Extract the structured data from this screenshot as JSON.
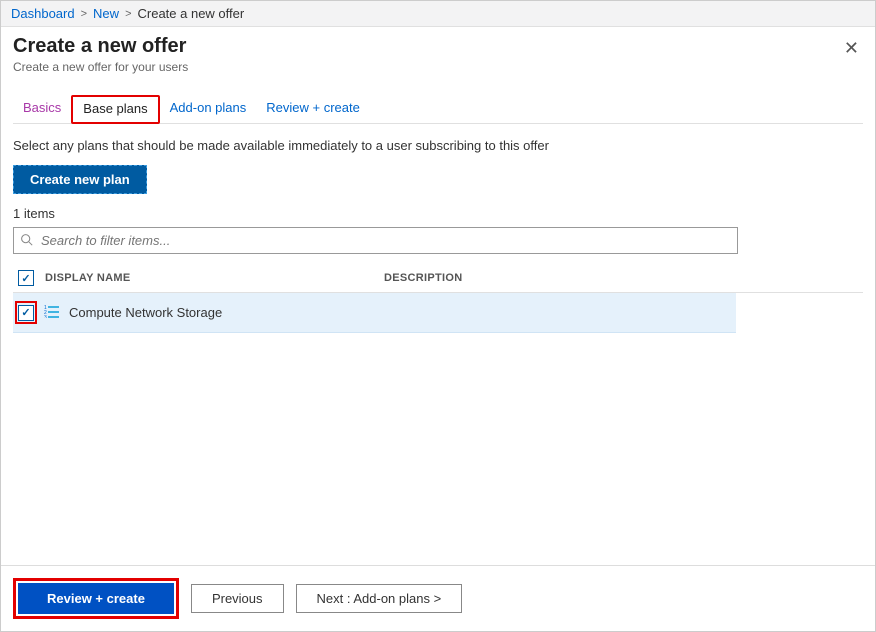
{
  "breadcrumb": {
    "items": [
      "Dashboard",
      "New"
    ],
    "current": "Create a new offer"
  },
  "header": {
    "title": "Create a new offer",
    "subtitle": "Create a new offer for your users"
  },
  "tabs": {
    "basics": "Basics",
    "base_plans": "Base plans",
    "addon_plans": "Add-on plans",
    "review_create": "Review + create"
  },
  "instructions": "Select any plans that should be made available immediately to a user subscribing to this offer",
  "create_plan_label": "Create new plan",
  "items_count": "1 items",
  "search_placeholder": "Search to filter items...",
  "columns": {
    "name": "DISPLAY NAME",
    "description": "DESCRIPTION"
  },
  "rows": [
    {
      "name": "Compute Network Storage",
      "checked": true
    }
  ],
  "footer": {
    "review_create": "Review + create",
    "previous": "Previous",
    "next": "Next : Add-on plans >"
  }
}
